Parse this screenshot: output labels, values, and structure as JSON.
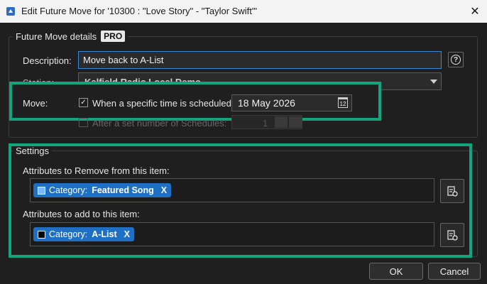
{
  "window": {
    "title": "Edit Future Move for '10300 : \"Love Story\" - \"Taylor Swift\"'",
    "close_glyph": "✕"
  },
  "details": {
    "legend": "Future Move details",
    "pro_badge": "PRO",
    "description_label": "Description:",
    "description_value": "Move back to A-List",
    "help_glyph": "?",
    "station_label": "Station:",
    "station_value": "Kalfield Radio Local Demo",
    "move_label": "Move:",
    "scheduled_label": "When a specific time is scheduled:",
    "scheduled_checked": "✓",
    "date_value": "18 May 2026",
    "calendar_glyph": "12",
    "after_label": "After a set number of Schedules:",
    "schedules_value": "1"
  },
  "settings": {
    "legend": "Settings",
    "remove_label": "Attributes to Remove from this item:",
    "remove_items": [
      {
        "category": "Category:",
        "value": "Featured Song",
        "close": "X",
        "swatch": "#7ab8ff"
      }
    ],
    "add_label": "Attributes to add to this item:",
    "add_items": [
      {
        "category": "Category:",
        "value": "A-List",
        "close": "X",
        "swatch": "#000000"
      }
    ]
  },
  "footer": {
    "ok_label": "OK",
    "cancel_label": "Cancel"
  },
  "colors": {
    "highlight": "#12a37f",
    "chip": "#1f6fc5",
    "focus": "#3a86d8"
  }
}
